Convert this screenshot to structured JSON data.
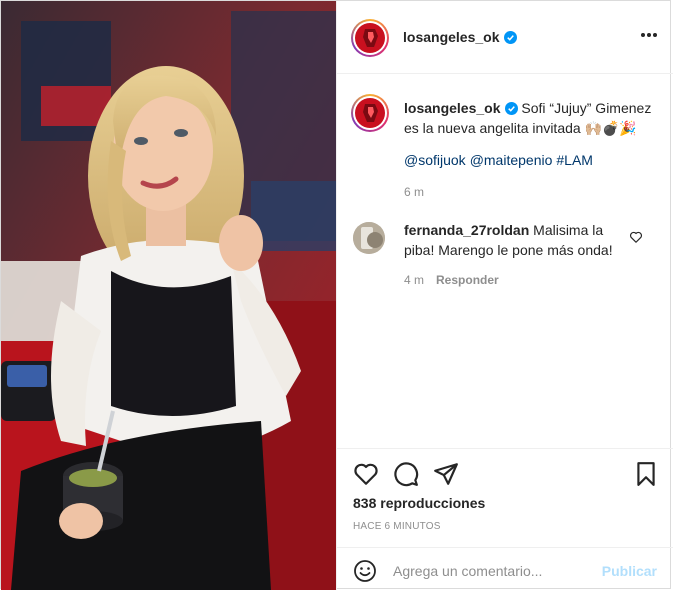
{
  "header": {
    "username": "losangeles_ok",
    "more_icon": "more-horizontal-icon"
  },
  "caption": {
    "username": "losangeles_ok",
    "text": "Sofi “Jujuy” Gimenez es la nueva angelita invitada 🙌🏼💣🎉",
    "tags": [
      "@sofijuok",
      "@maitepenio",
      "#LAM"
    ],
    "time": "6 m"
  },
  "comment": {
    "username": "fernanda_27roldan",
    "text": "Malisima la piba! Marengo le pone más onda!",
    "time": "4 m",
    "reply_label": "Responder"
  },
  "actions": {
    "icons": [
      "heart-icon",
      "comment-icon",
      "share-icon",
      "bookmark-icon"
    ],
    "views": "838 reproducciones",
    "posted": "HACE 6 MINUTOS"
  },
  "add_comment": {
    "placeholder": "Agrega un comentario...",
    "post_label": "Publicar"
  },
  "colors": {
    "brand_red": "#c9101f",
    "link": "#00376b",
    "muted": "#8e8e8e",
    "verified": "#0095f6",
    "post_disabled": "#b2dffc"
  }
}
